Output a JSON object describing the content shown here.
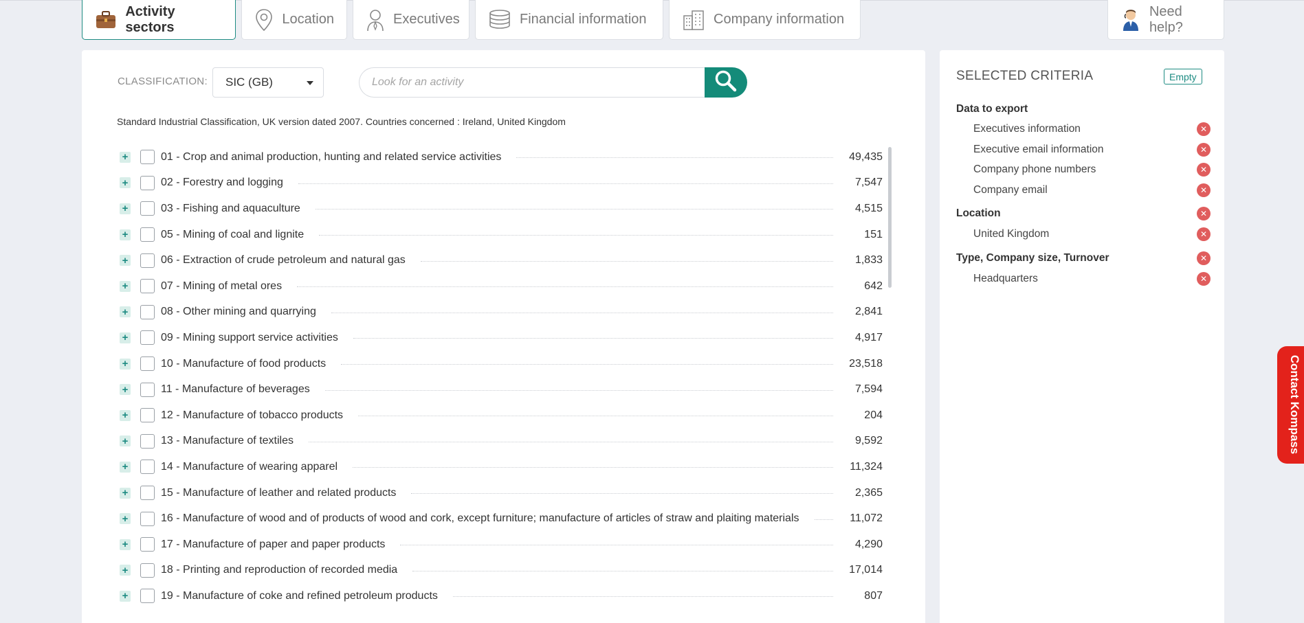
{
  "tabs": [
    {
      "label": "Activity sectors",
      "icon": "briefcase-icon"
    },
    {
      "label": "Location",
      "icon": "map-pin-icon"
    },
    {
      "label": "Executives",
      "icon": "executive-person-icon"
    },
    {
      "label": "Financial information",
      "icon": "coins-stack-icon"
    },
    {
      "label": "Company information",
      "icon": "buildings-icon"
    }
  ],
  "help": {
    "label": "Need help?",
    "icon": "support-agent-icon"
  },
  "classification": {
    "label": "CLASSIFICATION:",
    "selected": "SIC (GB)",
    "search_placeholder": "Look for an activity",
    "description": "Standard Industrial Classification, UK version dated 2007. Countries concerned : Ireland, United Kingdom"
  },
  "activities": [
    {
      "label": "01 - Crop and animal production, hunting and related service activities",
      "count": "49,435"
    },
    {
      "label": "02 - Forestry and logging",
      "count": "7,547"
    },
    {
      "label": "03 - Fishing and aquaculture",
      "count": "4,515"
    },
    {
      "label": "05 - Mining of coal and lignite",
      "count": "151"
    },
    {
      "label": "06 - Extraction of crude petroleum and natural gas",
      "count": "1,833"
    },
    {
      "label": "07 - Mining of metal ores",
      "count": "642"
    },
    {
      "label": "08 - Other mining and quarrying",
      "count": "2,841"
    },
    {
      "label": "09 - Mining support service activities",
      "count": "4,917"
    },
    {
      "label": "10 - Manufacture of food products",
      "count": "23,518"
    },
    {
      "label": "11 - Manufacture of beverages",
      "count": "7,594"
    },
    {
      "label": "12 - Manufacture of tobacco products",
      "count": "204"
    },
    {
      "label": "13 - Manufacture of textiles",
      "count": "9,592"
    },
    {
      "label": "14 - Manufacture of wearing apparel",
      "count": "11,324"
    },
    {
      "label": "15 - Manufacture of leather and related products",
      "count": "2,365"
    },
    {
      "label": "16 - Manufacture of wood and of products of wood and cork, except furniture; manufacture of articles of straw and plaiting materials",
      "count": "11,072"
    },
    {
      "label": "17 - Manufacture of paper and paper products",
      "count": "4,290"
    },
    {
      "label": "18 - Printing and reproduction of recorded media",
      "count": "17,014"
    },
    {
      "label": "19 - Manufacture of coke and refined petroleum products",
      "count": "807"
    }
  ],
  "selected_criteria": {
    "title": "SELECTED CRITERIA",
    "empty_label": "Empty",
    "group1": "Data to export",
    "items1": [
      "Executives information",
      "Executive email information",
      "Company phone numbers",
      "Company email"
    ],
    "group2": "Location",
    "items2": [
      "United Kingdom"
    ],
    "group3": "Type, Company size, Turnover",
    "items3": [
      "Headquarters"
    ]
  },
  "contact": {
    "label": "Contact Kompass"
  },
  "colors": {
    "accent": "#1d8b82",
    "search_button": "#148b79",
    "remove": "#e05d5d",
    "contact": "#e3221b"
  }
}
